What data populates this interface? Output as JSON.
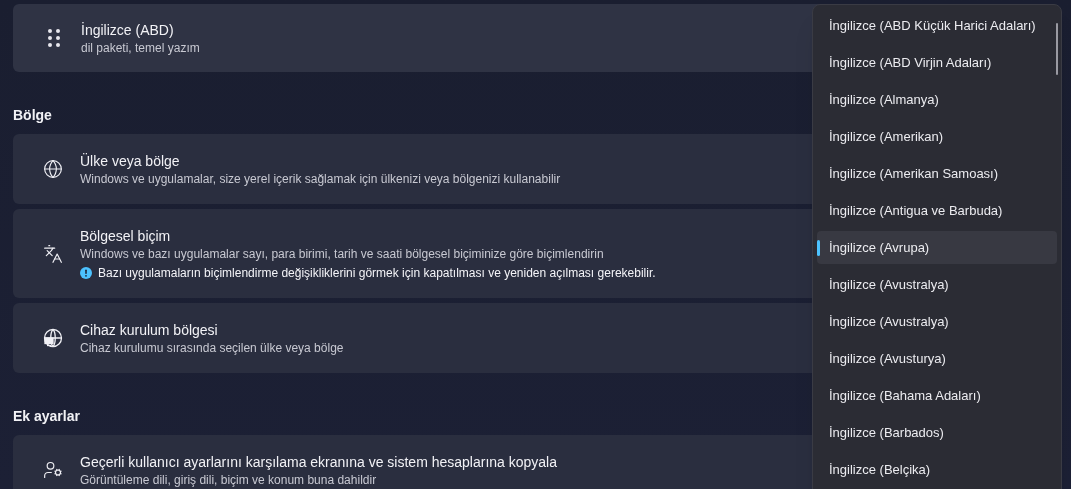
{
  "language_card": {
    "title": "İngilizce (ABD)",
    "subtitle": "dil paketi, temel yazım"
  },
  "sections": [
    {
      "heading": "Bölge",
      "cards": [
        {
          "title": "Ülke veya bölge",
          "subtitle": "Windows ve uygulamalar, size yerel içerik sağlamak için ülkenizi veya bölgenizi kullanabilir"
        },
        {
          "title": "Bölgesel biçim",
          "subtitle": "Windows ve bazı uygulamalar sayı, para birimi, tarih ve saati bölgesel biçiminize göre biçimlendirin",
          "notice": "Bazı uygulamaların biçimlendirme değişikliklerini görmek için kapatılması ve yeniden açılması gerekebilir."
        },
        {
          "title": "Cihaz kurulum bölgesi",
          "subtitle": "Cihaz kurulumu sırasında seçilen ülke veya bölge"
        }
      ]
    },
    {
      "heading": "Ek ayarlar",
      "cards": [
        {
          "title": "Geçerli kullanıcı ayarlarını karşılama ekranına ve sistem hesaplarına kopyala",
          "subtitle": "Görüntüleme dili, giriş dili, biçim ve konum buna dahildir"
        }
      ]
    }
  ],
  "dropdown": {
    "options": [
      {
        "label": "İngilizce (ABD Küçük Harici Adaları)",
        "selected": false
      },
      {
        "label": "İngilizce (ABD Virjin Adaları)",
        "selected": false
      },
      {
        "label": "İngilizce (Almanya)",
        "selected": false
      },
      {
        "label": "İngilizce (Amerikan)",
        "selected": false
      },
      {
        "label": "İngilizce (Amerikan Samoası)",
        "selected": false
      },
      {
        "label": "İngilizce (Antigua ve Barbuda)",
        "selected": false
      },
      {
        "label": "İngilizce (Avrupa)",
        "selected": true
      },
      {
        "label": "İngilizce (Avustralya)",
        "selected": false
      },
      {
        "label": "İngilizce (Avustralya)",
        "selected": false
      },
      {
        "label": "İngilizce (Avusturya)",
        "selected": false
      },
      {
        "label": "İngilizce (Bahama Adaları)",
        "selected": false
      },
      {
        "label": "İngilizce (Barbados)",
        "selected": false
      },
      {
        "label": "İngilizce (Belçika)",
        "selected": false
      }
    ]
  }
}
